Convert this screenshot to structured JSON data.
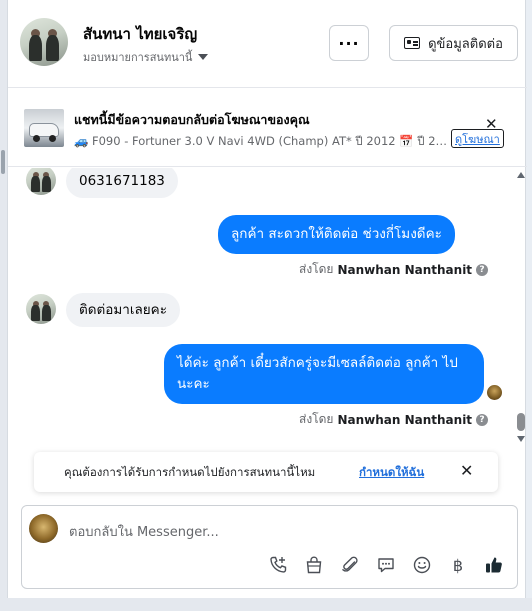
{
  "header": {
    "name": "สันทนา ไทยเจริญ",
    "assign_label": "มอบหมายการสนทนานี้",
    "more_label": "···",
    "contact_button": "ดูข้อมูลติดต่อ"
  },
  "ad": {
    "title": "แชทนี้มีข้อความตอบกลับต่อโฆษณาของคุณ",
    "subtitle": "🚙 F090 - Fortuner 3.0 V Navi 4WD (Champ) AT* ปี 2012 📅 ปี 201...",
    "view_button": "ดูโฆษณา",
    "close": "✕"
  },
  "messages": [
    {
      "direction": "in",
      "text": "0631671183"
    },
    {
      "direction": "out",
      "text": "ลูกค้า   สะดวกให้ติดต่อ ช่วงกี่โมงดีคะ",
      "sent_by_prefix": "ส่งโดย",
      "sent_by": "Nanwhan Nanthanit"
    },
    {
      "direction": "in",
      "text": "ติดต่อมาเลยคะ"
    },
    {
      "direction": "out",
      "text": "ได้ค่ะ  ลูกค้า    เดี๋ยวสักครู่จะมีเซลล์ติดต่อ ลูกค้า  ไปนะคะ",
      "sent_by_prefix": "ส่งโดย",
      "sent_by": "Nanwhan Nanthanit"
    }
  ],
  "followup": {
    "question": "คุณต้องการได้รับการกำหนดไปยังการสนทนานี้ไหม",
    "action": "กำหนดให้ฉัน",
    "close": "✕"
  },
  "composer": {
    "placeholder": "ตอบกลับใน Messenger..."
  },
  "toolbar_icons": [
    "phone-plus-icon",
    "shopping-bag-icon",
    "paperclip-icon",
    "chat-bubble-icon",
    "smiley-icon",
    "baht-icon",
    "thumbs-up-icon"
  ],
  "colors": {
    "accent": "#0a7cff",
    "link": "#216fdb",
    "incoming_bubble": "#f0f2f5"
  }
}
